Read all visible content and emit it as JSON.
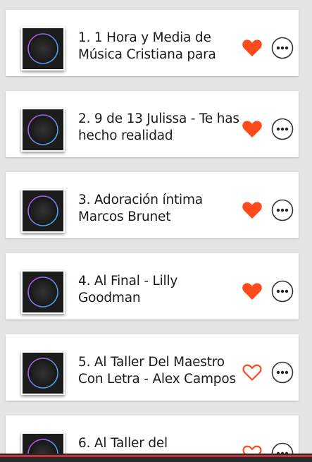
{
  "colors": {
    "accent": "#ff4a1c",
    "background": "#e4e4e4",
    "card": "#ffffff",
    "bottom_bar": "#2a2a2a",
    "bottom_bar_accent": "#c0313a"
  },
  "songs": [
    {
      "title": "1. 1 Hora y Media de Música Cristiana para",
      "favorite": true,
      "icon": "album-art-icon"
    },
    {
      "title": "2. 9 de 13 Julissa - Te has hecho realidad",
      "favorite": true,
      "icon": "album-art-icon"
    },
    {
      "title": "3. Adoración íntima Marcos Brunet",
      "favorite": true,
      "icon": "album-art-icon"
    },
    {
      "title": "4. Al Final - Lilly Goodman",
      "favorite": true,
      "icon": "album-art-icon"
    },
    {
      "title": "5. Al Taller Del Maestro Con Letra - Alex Campos",
      "favorite": false,
      "icon": "album-art-icon"
    },
    {
      "title": "6. Al Taller del",
      "favorite": false,
      "icon": "album-art-icon"
    }
  ]
}
